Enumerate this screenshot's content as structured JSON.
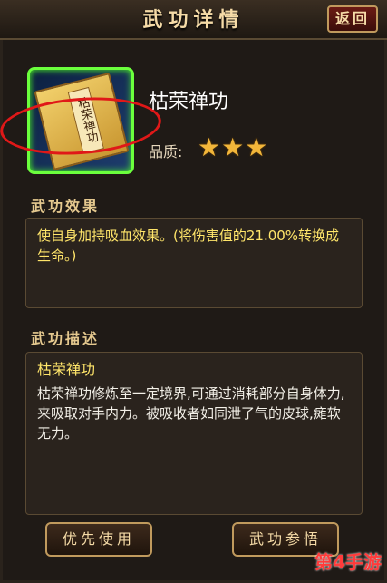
{
  "header": {
    "title": "武功详情",
    "back_label": "返回"
  },
  "skill": {
    "icon": "book-icon",
    "book_label": "枯荣禅功",
    "name": "枯荣禅功",
    "quality_label": "品质:",
    "stars": 3,
    "stars_text": "★★★"
  },
  "effect": {
    "title": "武功效果",
    "text": "使自身加持吸血效果。(将伤害值的21.00%转换成生命。)"
  },
  "description": {
    "title": "武功描述",
    "name": "枯荣禅功",
    "text": "枯荣禅功修炼至一定境界,可通过消耗部分自身体力,来吸取对手内力。被吸收者如同泄了气的皮球,瘫软无力。"
  },
  "buttons": {
    "use_label": "优先使用",
    "study_label": "武功参悟"
  },
  "watermark": "第4手游",
  "colors": {
    "accent": "#c09a5d",
    "highlight": "#ffe56a",
    "annotation": "#e01818"
  }
}
